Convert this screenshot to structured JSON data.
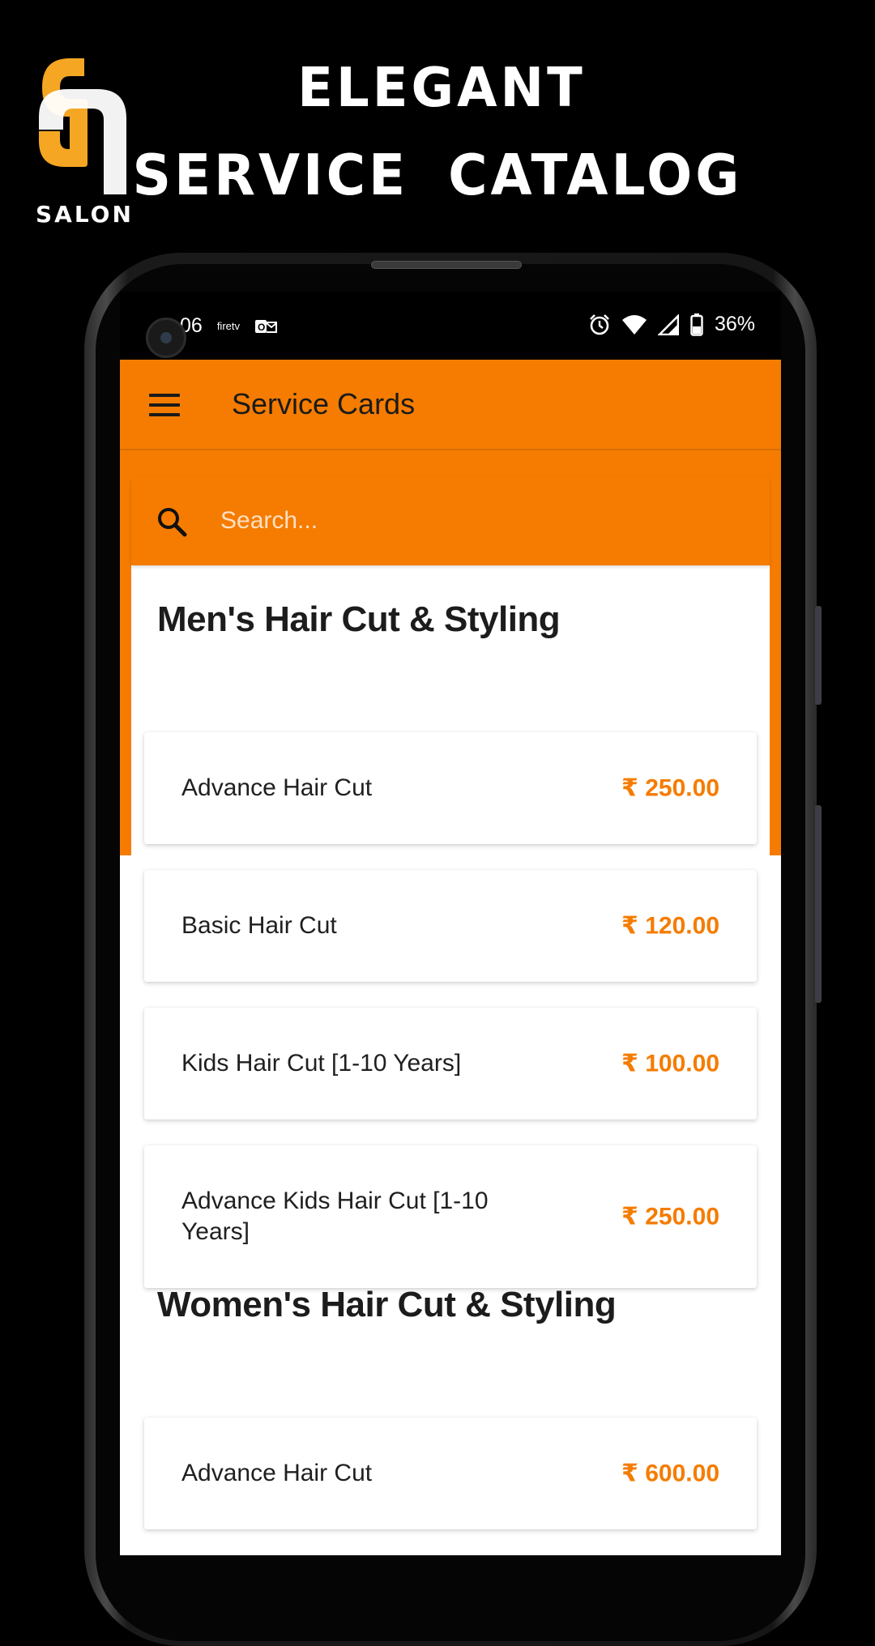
{
  "promo": {
    "brand_word": "SALON",
    "headline_1": "ELEGANT",
    "headline_2": "SERVICE CATALOG"
  },
  "status_bar": {
    "time_partial": "06",
    "left_icons": [
      "firetv-icon",
      "outlook-icon"
    ],
    "right_icons": [
      "alarm-icon",
      "wifi-icon",
      "signal-icon",
      "battery-icon"
    ],
    "battery": "36%"
  },
  "app_bar": {
    "title": "Service Cards"
  },
  "search": {
    "placeholder": "Search..."
  },
  "sections": [
    {
      "title": "Men's Hair Cut & Styling",
      "items": [
        {
          "name": "Advance Hair Cut",
          "price": "₹ 250.00"
        },
        {
          "name": "Basic Hair Cut",
          "price": "₹ 120.00"
        },
        {
          "name": "Kids Hair Cut [1-10 Years]",
          "price": "₹ 100.00"
        },
        {
          "name": "Advance Kids Hair Cut [1-10 Years]",
          "price": "₹ 250.00"
        }
      ]
    },
    {
      "title": "Women's Hair Cut & Styling",
      "items": [
        {
          "name": "Advance Hair Cut",
          "price": "₹ 600.00"
        }
      ]
    }
  ],
  "colors": {
    "accent": "#f57c00",
    "background": "#000000"
  }
}
